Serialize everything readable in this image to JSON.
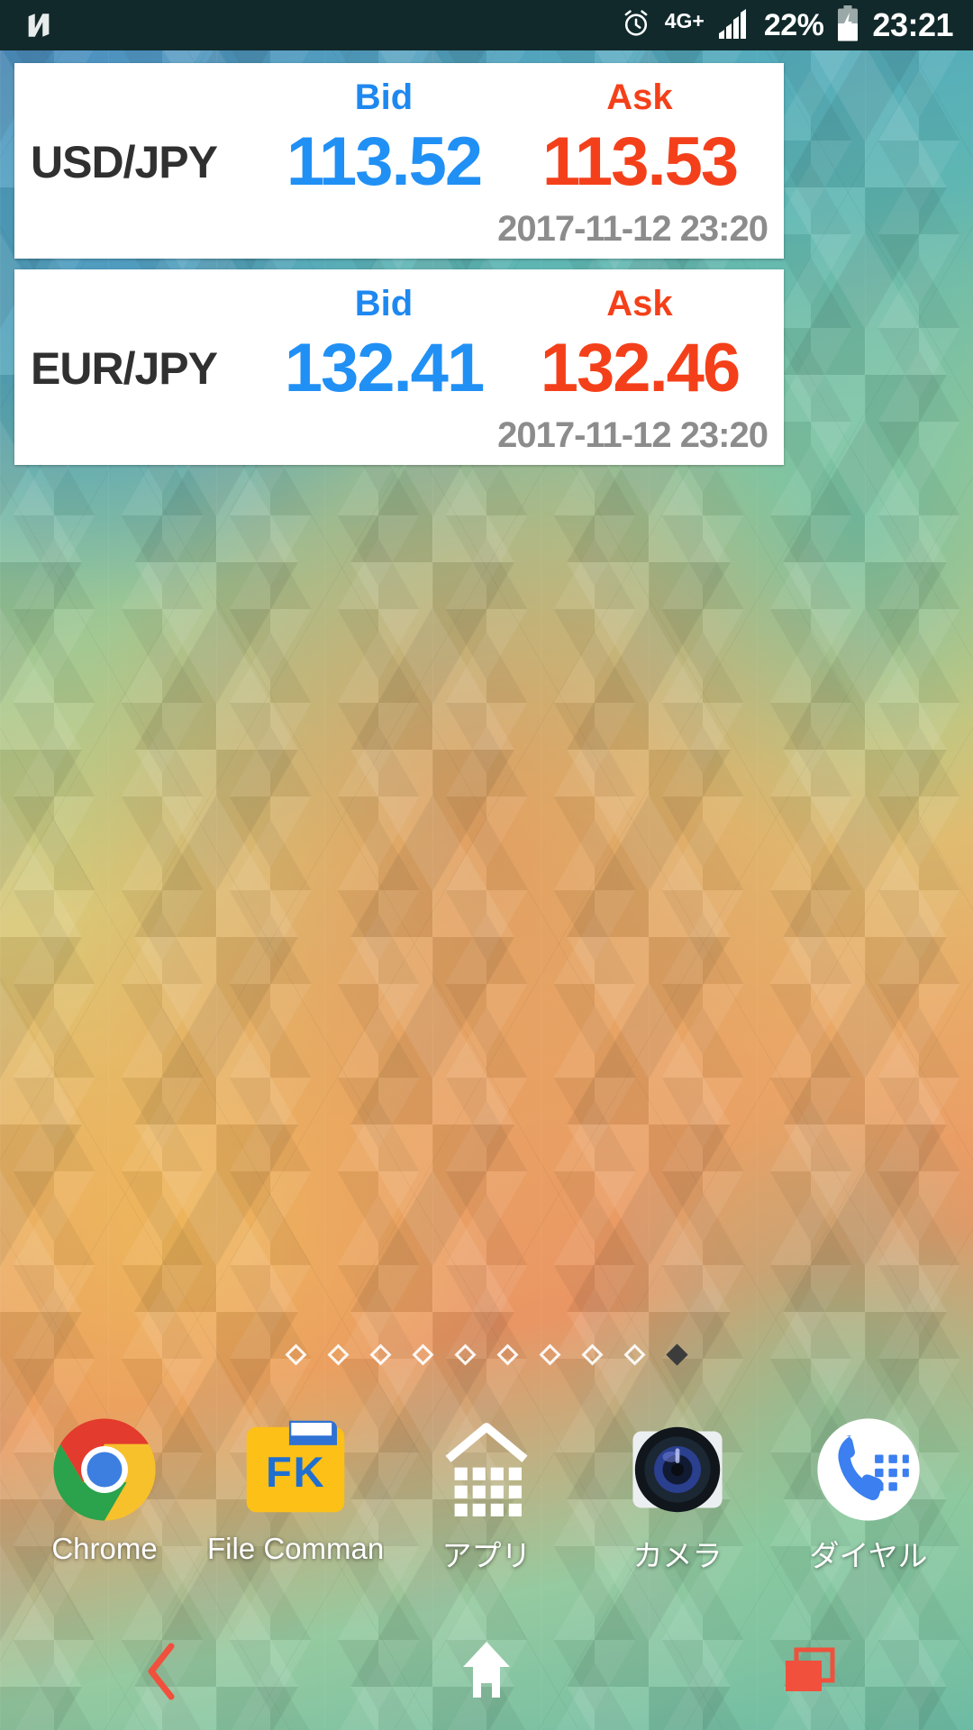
{
  "status_bar": {
    "notification_icon": "android-n-logo-icon",
    "alarm_icon": "alarm-clock-icon",
    "network_type": "4G+",
    "signal_icon": "signal-bars-icon",
    "battery_percent": "22%",
    "battery_icon": "battery-charging-icon",
    "clock": "23:21",
    "background_color": "#11292b",
    "text_color": "#ffffff"
  },
  "widgets": {
    "column_headers": {
      "bid": "Bid",
      "ask": "Ask"
    },
    "colors": {
      "bid": "#2090f5",
      "ask": "#f4401a",
      "pair": "#303030",
      "timestamp": "#8c8c8c",
      "card_bg": "#ffffff"
    },
    "cards": [
      {
        "pair": "USD/JPY",
        "bid_label": "Bid",
        "ask_label": "Ask",
        "bid": "113.52",
        "ask": "113.53",
        "timestamp": "2017-11-12 23:20"
      },
      {
        "pair": "EUR/JPY",
        "bid_label": "Bid",
        "ask_label": "Ask",
        "bid": "132.41",
        "ask": "132.46",
        "timestamp": "2017-11-12 23:20"
      }
    ]
  },
  "page_indicator": {
    "count": 10,
    "active_index": 9
  },
  "dock": {
    "items": [
      {
        "label": "Chrome",
        "icon": "chrome-icon"
      },
      {
        "label": "File Commander",
        "icon": "file-commander-icon"
      },
      {
        "label": "アプリ",
        "icon": "app-drawer-icon"
      },
      {
        "label": "カメラ",
        "icon": "camera-icon"
      },
      {
        "label": "ダイヤル",
        "icon": "dialer-icon"
      }
    ]
  },
  "nav_bar": {
    "back_label": "Back",
    "home_label": "Home",
    "recents_label": "Recents",
    "accent_color": "#f0503c"
  }
}
